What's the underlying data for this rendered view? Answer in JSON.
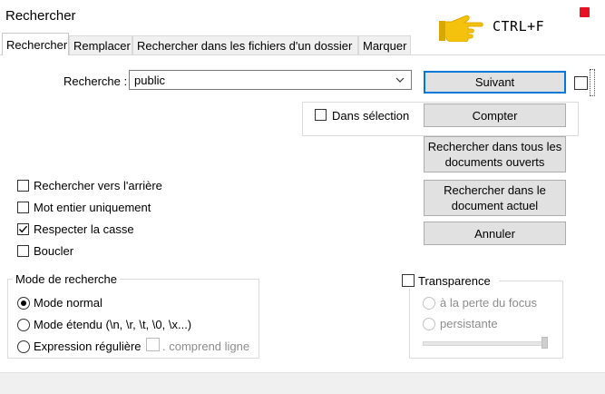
{
  "window": {
    "title": "Rechercher",
    "shortcut_hint": "CTRL+F"
  },
  "tabs": [
    {
      "label": "Rechercher",
      "active": true
    },
    {
      "label": "Remplacer",
      "active": false
    },
    {
      "label": "Rechercher dans les fichiers d'un dossier",
      "active": false
    },
    {
      "label": "Marquer",
      "active": false
    }
  ],
  "search": {
    "label": "Recherche :",
    "value": "public"
  },
  "in_selection": {
    "label": "Dans sélection",
    "checked": false
  },
  "buttons": {
    "next": "Suivant",
    "count": "Compter",
    "find_all_open_line1": "Rechercher dans tous les",
    "find_all_open_line2": "documents ouverts",
    "find_all_current_line1": "Rechercher dans le",
    "find_all_current_line2": "document actuel",
    "cancel": "Annuler"
  },
  "options": {
    "backward": {
      "label": "Rechercher vers l'arrière",
      "checked": false
    },
    "whole_word": {
      "label": "Mot entier uniquement",
      "checked": false
    },
    "match_case": {
      "label": "Respecter la casse",
      "checked": true
    },
    "wrap": {
      "label": "Boucler",
      "checked": false
    }
  },
  "search_mode": {
    "title": "Mode de recherche",
    "normal": {
      "label": "Mode normal",
      "selected": true
    },
    "extended": {
      "label": "Mode étendu (\\n, \\r, \\t, \\0, \\x...)",
      "selected": false
    },
    "regex": {
      "label": "Expression régulière",
      "selected": false
    },
    "dot_newline": {
      "label": ". comprend ligne",
      "checked": false
    }
  },
  "transparency": {
    "label": "Transparence",
    "checked": false,
    "on_focus_loss": "à la perte du focus",
    "always": "persistante",
    "level": 1.0
  }
}
